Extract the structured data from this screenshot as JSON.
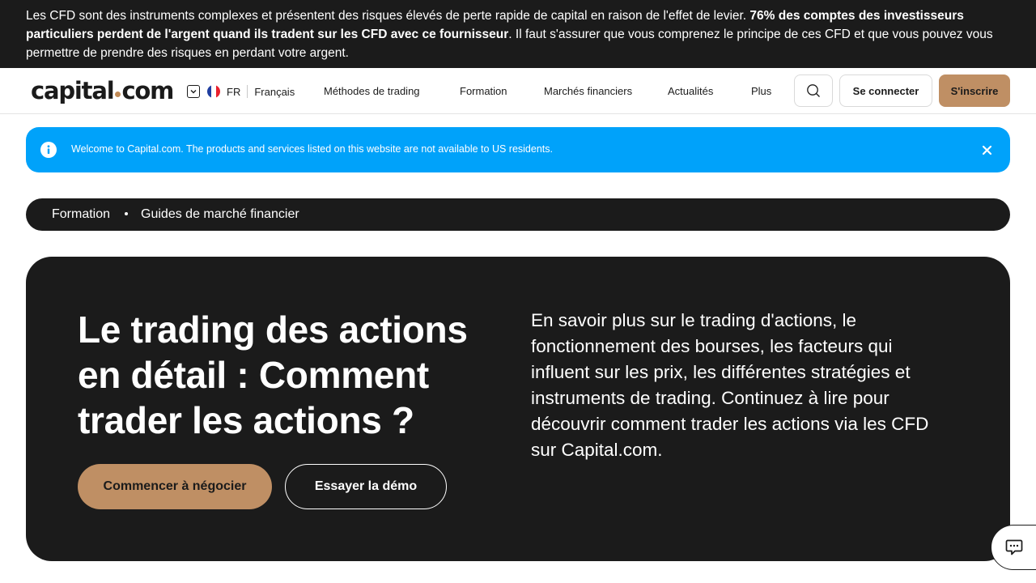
{
  "risk_banner": {
    "text_before": "Les CFD sont des instruments complexes et présentent des risques élevés de perte rapide de capital en raison de l'effet de levier. ",
    "text_bold": "76% des comptes des investisseurs particuliers perdent de l'argent quand ils tradent sur les CFD avec ce fournisseur",
    "text_after": ". Il faut s'assurer que vous comprenez le principe de ces CFD et que vous pouvez vous permettre de prendre des risques en perdant votre argent."
  },
  "header": {
    "logo_left": "capital",
    "logo_right": "com",
    "lang_code": "FR",
    "lang_name": "Français",
    "nav": [
      "Méthodes de trading",
      "Formation",
      "Marchés financiers",
      "Actualités",
      "Plus"
    ],
    "login_label": "Se connecter",
    "signup_label": "S'inscrire"
  },
  "notice": {
    "text": "Welcome to Capital.com. The products and services listed on this website are not available to US residents."
  },
  "breadcrumb": [
    "Formation",
    "Guides de marché financier"
  ],
  "hero": {
    "title": "Le trading des actions en détail : Comment trader les actions ?",
    "description": "En savoir plus sur le trading d'actions, le fonctionnement des bourses, les facteurs qui influent sur les prix, les différentes stratégies et instruments de trading. Continuez à lire pour découvrir comment trader les actions via les CFD sur Capital.com.",
    "cta_primary": "Commencer à négocier",
    "cta_secondary": "Essayer la démo"
  },
  "colors": {
    "dark": "#1b1b1b",
    "accent_gold": "#bf8f64",
    "notice_blue": "#00a2fa",
    "flag_blue": "#1f3ea0",
    "flag_red": "#e8202d"
  },
  "icons": {
    "search": "search-icon",
    "info": "info-icon",
    "close": "close-icon",
    "chat": "chat-icon",
    "chevron": "chevron-down-icon",
    "flag": "flag-fr-icon"
  }
}
